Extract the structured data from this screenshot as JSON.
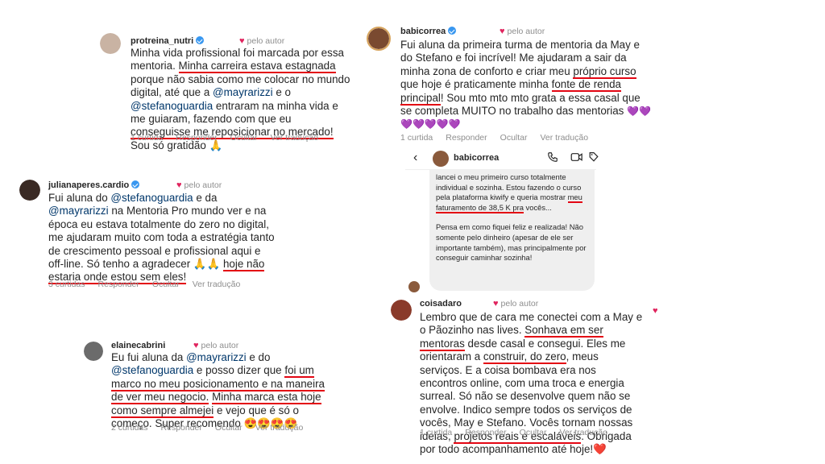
{
  "comments": [
    {
      "username": "protreina_nutri",
      "by_author": "pelo autor",
      "text_segments": [
        "Minha vida profissional foi marcada por essa mentoria. ",
        "Minha carreira estava estagnada",
        " porque não sabia como me colocar no mundo digital, até que a ",
        "@mayrarizzi",
        " e o ",
        "@stefanoguardia",
        " entraram na minha vida e me guiaram, fazendo com que eu ",
        "conseguisse me reposicionar no mercado!",
        " Sou só gratidão 🙏"
      ],
      "actions": [
        "1 curtida",
        "Responder",
        "Ocultar",
        "Ver tradução"
      ]
    },
    {
      "username": "julianaperes.cardio",
      "by_author": "pelo autor",
      "text_segments": [
        "Fui aluna do ",
        "@stefanoguardia",
        " e da ",
        "@mayrarizzi",
        " na Mentoria Pro mundo ver e na época eu estava totalmente do zero no digital, me ajudaram muito com toda a estratégia tanto de crescimento pessoal e profissional aqui e off-line. Só tenho a agradecer 🙏🙏 ",
        "hoje não estaria onde estou sem eles!"
      ],
      "actions": [
        "3 curtidas",
        "Responder",
        "Ocultar",
        "Ver tradução"
      ]
    },
    {
      "username": "elainecabrini",
      "by_author": "pelo autor",
      "text_segments": [
        "Eu fui aluna da ",
        "@mayrarizzi",
        " e do ",
        "@stefanoguardia",
        " e posso dizer que ",
        "foi um marco no meu posicionamento e na maneira de ver meu negocio.",
        " ",
        "Minha marca esta hoje como sempre almejei",
        " e vejo que é só o começo. Super recomendo 😍😍😍😍"
      ],
      "actions": [
        "2 curtidas",
        "Responder",
        "Ocultar",
        "Ver tradução"
      ]
    },
    {
      "username": "babicorrea",
      "by_author": "pelo autor",
      "text_segments": [
        "Fui aluna da primeira turma de mentoria da May e do Stefano e foi incrível! Me ajudaram a sair da minha zona de conforto e criar meu ",
        "próprio curso",
        " que hoje é praticamente minha ",
        "fonte de renda principal",
        "! Sou mto mto mto grata a essa casal que se completa MUITO no trabalho das mentorias ",
        "💜💜💜💜💜💜💜"
      ],
      "actions": [
        "1 curtida",
        "Responder",
        "Ocultar",
        "Ver tradução"
      ]
    },
    {
      "username": "coisadaro",
      "by_author": "pelo autor",
      "text_segments": [
        "Lembro que de cara me conectei com a May e o Pãozinho nas lives. ",
        "Sonhava em ser mentoras",
        " desde casal e consegui. Eles me orientaram a ",
        "construir, do zero",
        ", meus serviços. E a coisa bombava era nos encontros online, com uma troca e energia surreal. Só não se desenvolve quem não se envolve. Indico sempre todos os serviços de vocês, May e Stefano. Vocês tornam nossas ideias, ",
        "projetos reais e escaláveis",
        ". Obrigada por todo acompanhamento até hoje!❤️"
      ],
      "actions": [
        "1 curtida",
        "Responder",
        "Ocultar",
        "Ver tradução"
      ]
    }
  ],
  "dm": {
    "back_icon": "chevron-left-icon",
    "username": "babicorrea",
    "header_icons": [
      "phone-icon",
      "video-icon",
      "tag-icon"
    ],
    "message_segments": [
      "lancei o meu primeiro curso totalmente individual e sozinha. Estou fazendo o curso pela plataforma kiwify e queria mostrar ",
      "meu faturamento de 38,5 K pra",
      " vocês..."
    ],
    "message_p2": "Pensa em como fiquei feliz e realizada! Não somente pelo dinheiro (apesar de ele ser importante também), mas principalmente por conseguir caminhar sozinha!"
  },
  "colors": {
    "underline": "#e30613",
    "mention": "#00376b",
    "heart": "#e0245e",
    "verified": "#3897f0"
  }
}
